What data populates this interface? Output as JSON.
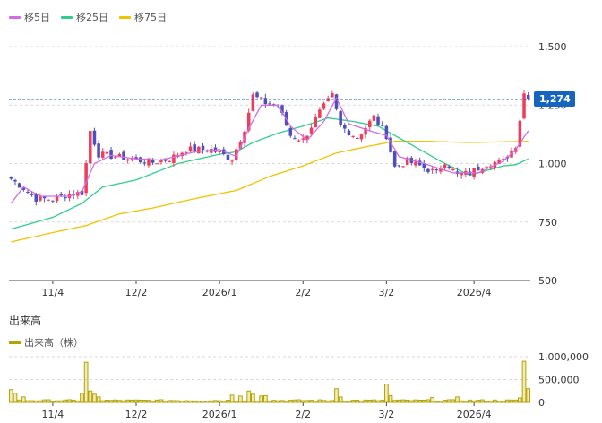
{
  "legend": {
    "ma5": {
      "label": "移5日",
      "color": "#d36be5"
    },
    "ma25": {
      "label": "移25日",
      "color": "#2dcf8c"
    },
    "ma75": {
      "label": "移75日",
      "color": "#f2c200"
    }
  },
  "volume": {
    "title": "出来高",
    "legend_label": "出来高（株）",
    "color": "#b5a300"
  },
  "current_price": {
    "label": "1,274",
    "value": 1274
  },
  "chart_data": [
    {
      "type": "candlestick",
      "title": "",
      "xlabel": "",
      "ylabel": "",
      "ylim": [
        500,
        1500
      ],
      "yticks": [
        500,
        750,
        1000,
        1250,
        1500
      ],
      "ytick_labels": [
        "500",
        "750",
        "1,000",
        "1,250",
        "1,500"
      ],
      "xtick_labels": [
        {
          "label": "11/4",
          "index": 10
        },
        {
          "label": "12/2",
          "index": 30
        },
        {
          "label": "2026/1",
          "index": 50
        },
        {
          "label": "2/2",
          "index": 70
        },
        {
          "label": "3/2",
          "index": 90
        },
        {
          "label": "2026/4",
          "index": 111
        }
      ],
      "n_days": 125,
      "up_color": "#ef3e5b",
      "down_color": "#4d4fba",
      "ohlc_keypoints": [
        {
          "i": 0,
          "close": 935
        },
        {
          "i": 3,
          "close": 895
        },
        {
          "i": 6,
          "close": 850
        },
        {
          "i": 10,
          "close": 848
        },
        {
          "i": 14,
          "close": 870
        },
        {
          "i": 17,
          "close": 875
        },
        {
          "i": 18,
          "close": 1000
        },
        {
          "i": 19,
          "close": 1140
        },
        {
          "i": 21,
          "close": 1040
        },
        {
          "i": 25,
          "close": 1030
        },
        {
          "i": 30,
          "close": 1015
        },
        {
          "i": 34,
          "close": 1005
        },
        {
          "i": 38,
          "close": 1020
        },
        {
          "i": 42,
          "close": 1060
        },
        {
          "i": 48,
          "close": 1060
        },
        {
          "i": 53,
          "close": 1020
        },
        {
          "i": 56,
          "close": 1150
        },
        {
          "i": 58,
          "close": 1290
        },
        {
          "i": 61,
          "close": 1260
        },
        {
          "i": 64,
          "close": 1250
        },
        {
          "i": 67,
          "close": 1120
        },
        {
          "i": 70,
          "close": 1100
        },
        {
          "i": 74,
          "close": 1220
        },
        {
          "i": 77,
          "close": 1290
        },
        {
          "i": 79,
          "close": 1160
        },
        {
          "i": 83,
          "close": 1110
        },
        {
          "i": 87,
          "close": 1200
        },
        {
          "i": 90,
          "close": 1120
        },
        {
          "i": 92,
          "close": 985
        },
        {
          "i": 95,
          "close": 1010
        },
        {
          "i": 98,
          "close": 990
        },
        {
          "i": 102,
          "close": 960
        },
        {
          "i": 104,
          "close": 1010
        },
        {
          "i": 107,
          "close": 950
        },
        {
          "i": 110,
          "close": 960
        },
        {
          "i": 114,
          "close": 1000
        },
        {
          "i": 118,
          "close": 1010
        },
        {
          "i": 121,
          "close": 1080
        },
        {
          "i": 123,
          "close": 1300
        },
        {
          "i": 124,
          "close": 1274
        }
      ],
      "ma25_keypoints": [
        {
          "i": 0,
          "v": 720
        },
        {
          "i": 10,
          "v": 770
        },
        {
          "i": 17,
          "v": 830
        },
        {
          "i": 22,
          "v": 900
        },
        {
          "i": 30,
          "v": 930
        },
        {
          "i": 40,
          "v": 1000
        },
        {
          "i": 50,
          "v": 1040
        },
        {
          "i": 54,
          "v": 1050
        },
        {
          "i": 58,
          "v": 1090
        },
        {
          "i": 64,
          "v": 1130
        },
        {
          "i": 70,
          "v": 1160
        },
        {
          "i": 76,
          "v": 1195
        },
        {
          "i": 82,
          "v": 1180
        },
        {
          "i": 88,
          "v": 1160
        },
        {
          "i": 92,
          "v": 1120
        },
        {
          "i": 98,
          "v": 1060
        },
        {
          "i": 104,
          "v": 1000
        },
        {
          "i": 110,
          "v": 950
        },
        {
          "i": 114,
          "v": 970
        },
        {
          "i": 118,
          "v": 990
        },
        {
          "i": 121,
          "v": 995
        },
        {
          "i": 124,
          "v": 1020
        }
      ],
      "ma75_keypoints": [
        {
          "i": 0,
          "v": 665
        },
        {
          "i": 10,
          "v": 705
        },
        {
          "i": 18,
          "v": 735
        },
        {
          "i": 26,
          "v": 785
        },
        {
          "i": 34,
          "v": 810
        },
        {
          "i": 44,
          "v": 850
        },
        {
          "i": 54,
          "v": 885
        },
        {
          "i": 62,
          "v": 945
        },
        {
          "i": 70,
          "v": 990
        },
        {
          "i": 78,
          "v": 1045
        },
        {
          "i": 86,
          "v": 1075
        },
        {
          "i": 92,
          "v": 1095
        },
        {
          "i": 100,
          "v": 1095
        },
        {
          "i": 110,
          "v": 1090
        },
        {
          "i": 124,
          "v": 1095
        }
      ],
      "ma5_keypoints": [
        {
          "i": 0,
          "v": 830
        },
        {
          "i": 3,
          "v": 900
        },
        {
          "i": 7,
          "v": 860
        },
        {
          "i": 14,
          "v": 860
        },
        {
          "i": 17,
          "v": 880
        },
        {
          "i": 20,
          "v": 1000
        },
        {
          "i": 24,
          "v": 1035
        },
        {
          "i": 30,
          "v": 1020
        },
        {
          "i": 36,
          "v": 1015
        },
        {
          "i": 44,
          "v": 1050
        },
        {
          "i": 50,
          "v": 1060
        },
        {
          "i": 54,
          "v": 1030
        },
        {
          "i": 57,
          "v": 1150
        },
        {
          "i": 60,
          "v": 1250
        },
        {
          "i": 64,
          "v": 1250
        },
        {
          "i": 67,
          "v": 1160
        },
        {
          "i": 71,
          "v": 1100
        },
        {
          "i": 75,
          "v": 1180
        },
        {
          "i": 78,
          "v": 1280
        },
        {
          "i": 81,
          "v": 1170
        },
        {
          "i": 86,
          "v": 1140
        },
        {
          "i": 90,
          "v": 1120
        },
        {
          "i": 93,
          "v": 1030
        },
        {
          "i": 99,
          "v": 1000
        },
        {
          "i": 106,
          "v": 960
        },
        {
          "i": 112,
          "v": 960
        },
        {
          "i": 118,
          "v": 1010
        },
        {
          "i": 121,
          "v": 1060
        },
        {
          "i": 124,
          "v": 1140
        }
      ]
    },
    {
      "type": "bar",
      "title": "出来高",
      "ylim": [
        0,
        1000000
      ],
      "yticks": [
        0,
        500000,
        1000000
      ],
      "ytick_labels": [
        "0",
        "500,000",
        "1,000,000"
      ],
      "baseline_volume": 40000,
      "spikes": [
        {
          "i": 0,
          "v": 280000
        },
        {
          "i": 1,
          "v": 200000
        },
        {
          "i": 3,
          "v": 120000
        },
        {
          "i": 17,
          "v": 200000
        },
        {
          "i": 18,
          "v": 880000
        },
        {
          "i": 19,
          "v": 250000
        },
        {
          "i": 20,
          "v": 180000
        },
        {
          "i": 21,
          "v": 120000
        },
        {
          "i": 53,
          "v": 160000
        },
        {
          "i": 55,
          "v": 140000
        },
        {
          "i": 57,
          "v": 250000
        },
        {
          "i": 58,
          "v": 180000
        },
        {
          "i": 60,
          "v": 140000
        },
        {
          "i": 61,
          "v": 150000
        },
        {
          "i": 78,
          "v": 300000
        },
        {
          "i": 79,
          "v": 120000
        },
        {
          "i": 90,
          "v": 400000
        },
        {
          "i": 91,
          "v": 150000
        },
        {
          "i": 101,
          "v": 110000
        },
        {
          "i": 107,
          "v": 120000
        },
        {
          "i": 122,
          "v": 100000
        },
        {
          "i": 123,
          "v": 900000
        },
        {
          "i": 124,
          "v": 300000
        }
      ]
    }
  ]
}
